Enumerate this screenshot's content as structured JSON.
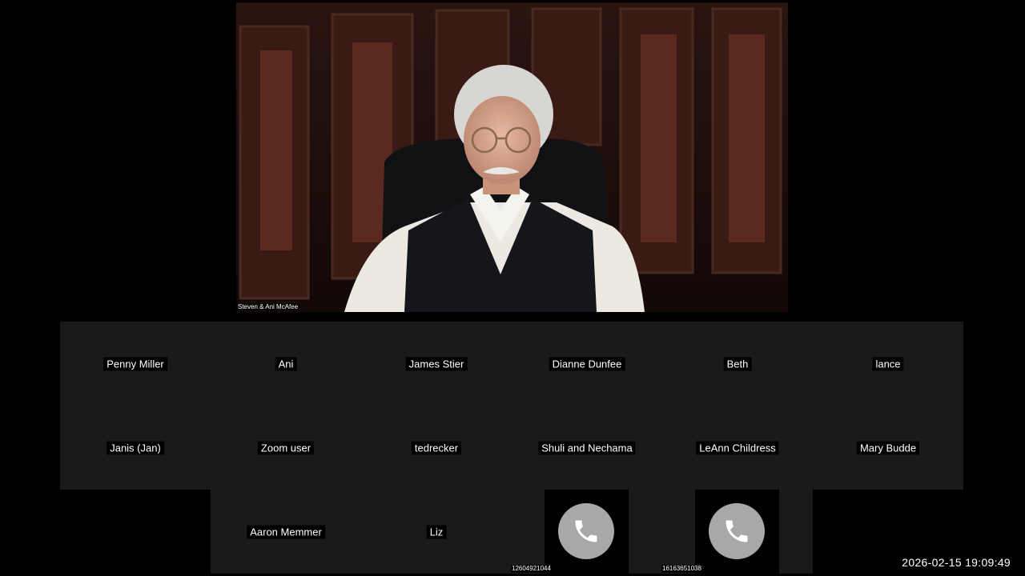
{
  "speaker": {
    "name": "Steven & Ani McAfee"
  },
  "gallery": {
    "row1": [
      {
        "name": "Penny Miller"
      },
      {
        "name": "Ani"
      },
      {
        "name": "James Stier"
      },
      {
        "name": "Dianne Dunfee"
      },
      {
        "name": "Beth"
      },
      {
        "name": "lance"
      }
    ],
    "row2": [
      {
        "name": "Janis (Jan)"
      },
      {
        "name": "Zoom user"
      },
      {
        "name": "tedrecker"
      },
      {
        "name": "Shuli and Nechama"
      },
      {
        "name": "LeAnn Childress"
      },
      {
        "name": "Mary Budde"
      }
    ],
    "row3": [
      {
        "name": "Aaron Memmer"
      },
      {
        "name": "Liz"
      },
      {
        "phone": "12604921044",
        "icon": "phone-icon"
      },
      {
        "phone": "16163651038",
        "icon": "phone-icon"
      }
    ]
  },
  "timestamp": "2026-02-15  19:09:49",
  "colors": {
    "background": "#000000",
    "tile": "#1a1a1a",
    "phone_circle": "#a8a8a8"
  }
}
